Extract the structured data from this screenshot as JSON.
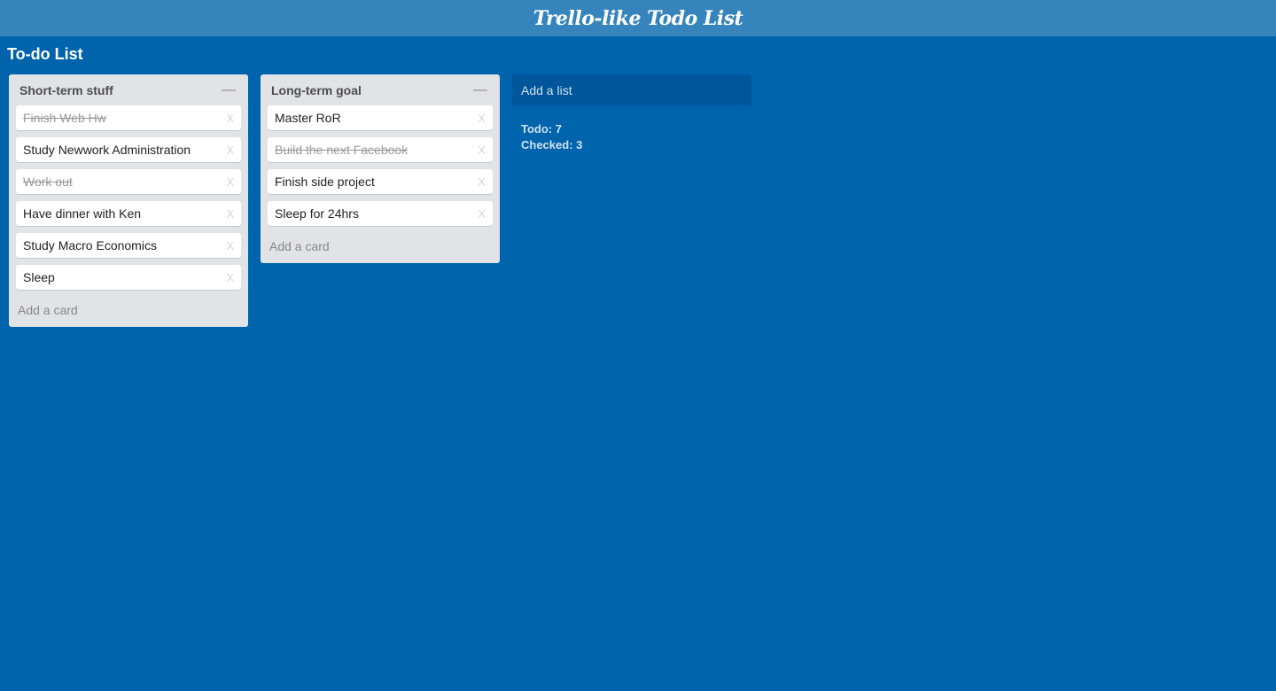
{
  "header": {
    "app_title": "Trello-like Todo List"
  },
  "board": {
    "title": "To-do List"
  },
  "lists": [
    {
      "title": "Short-term stuff",
      "minimize_icon": "—",
      "add_card_label": "Add a card",
      "cards": [
        {
          "text": "Finish Web Hw",
          "done": true,
          "delete_label": "X"
        },
        {
          "text": "Study Newwork Administration",
          "done": false,
          "delete_label": "X"
        },
        {
          "text": "Work out",
          "done": true,
          "delete_label": "X"
        },
        {
          "text": "Have dinner with Ken",
          "done": false,
          "delete_label": "X"
        },
        {
          "text": "Study Macro Economics",
          "done": false,
          "delete_label": "X"
        },
        {
          "text": "Sleep",
          "done": false,
          "delete_label": "X"
        }
      ]
    },
    {
      "title": "Long-term goal",
      "minimize_icon": "—",
      "add_card_label": "Add a card",
      "cards": [
        {
          "text": "Master RoR",
          "done": false,
          "delete_label": "X"
        },
        {
          "text": "Build the next Facebook",
          "done": true,
          "delete_label": "X"
        },
        {
          "text": "Finish side project",
          "done": false,
          "delete_label": "X"
        },
        {
          "text": "Sleep for 24hrs",
          "done": false,
          "delete_label": "X"
        }
      ]
    }
  ],
  "add_list_label": "Add a list",
  "stats": {
    "todo": "Todo: 7",
    "checked": "Checked: 3"
  },
  "colors": {
    "background": "#0064ac",
    "topbar": "#3584bc",
    "list_bg": "#e2e3e6",
    "add_list_bg": "#00569a"
  }
}
